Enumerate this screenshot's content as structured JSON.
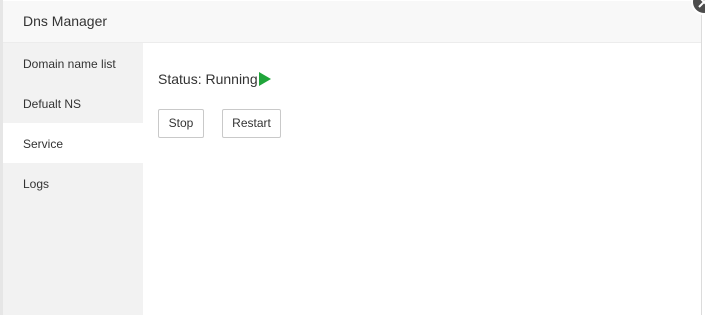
{
  "window": {
    "title": "Dns Manager"
  },
  "sidebar": {
    "items": [
      {
        "label": "Domain name list",
        "active": false
      },
      {
        "label": "Defualt NS",
        "active": false
      },
      {
        "label": "Service",
        "active": true
      },
      {
        "label": "Logs",
        "active": false
      }
    ]
  },
  "service": {
    "status_text": "Status: Running",
    "status_icon": "play-icon",
    "status_color": "#20a53a",
    "buttons": {
      "stop_label": "Stop",
      "restart_label": "Restart"
    }
  },
  "icons": {
    "close": "close-icon"
  }
}
